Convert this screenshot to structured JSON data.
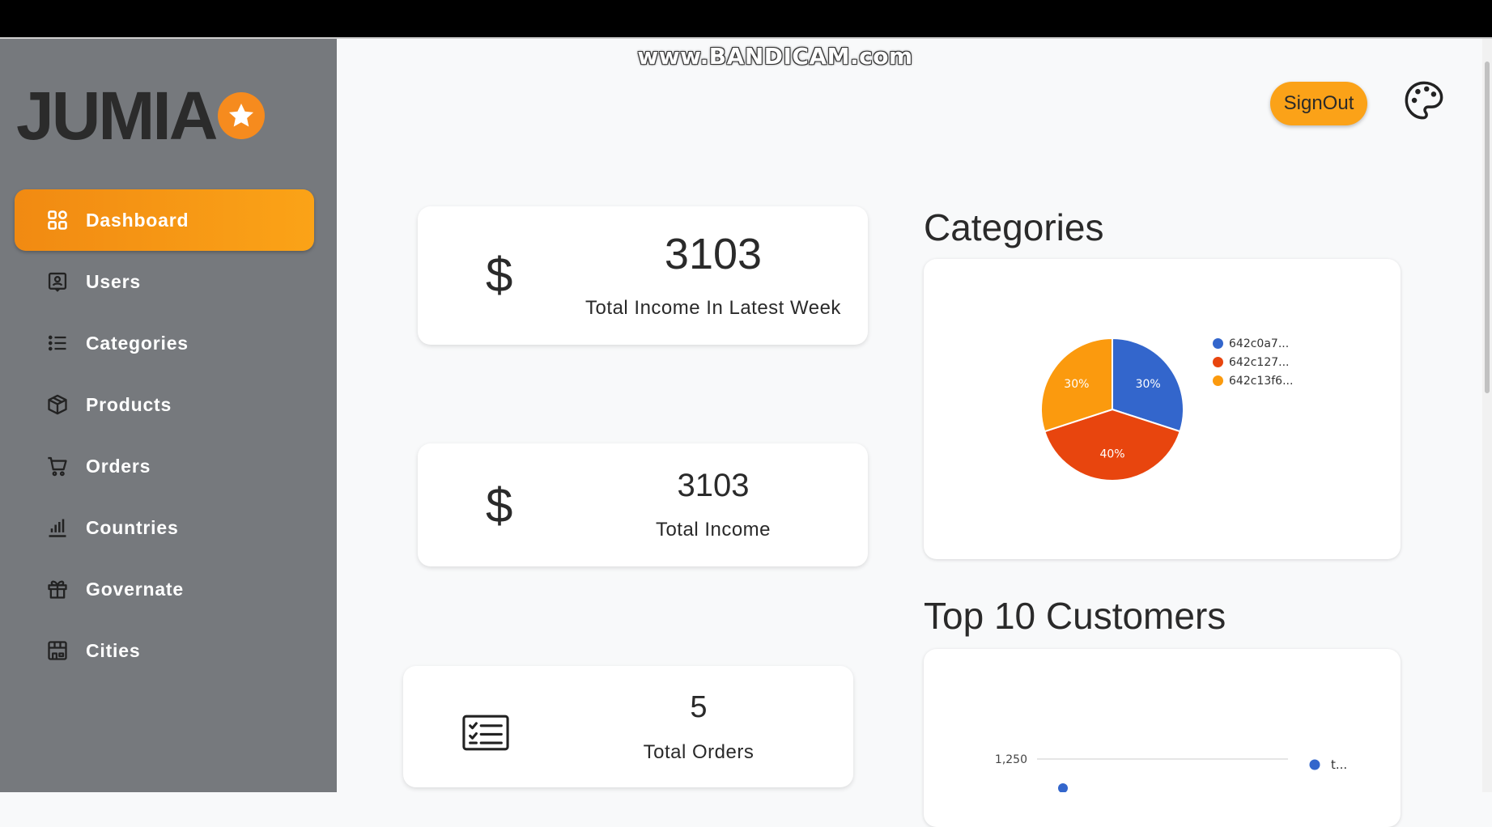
{
  "watermark": "www.BANDICAM.com",
  "brand": {
    "logo_text": "JUMIA",
    "logo_icon": "star-icon",
    "accent": "#f68b1e"
  },
  "sidebar": {
    "items": [
      {
        "label": "Dashboard",
        "icon": "dashboard-grid-icon",
        "active": true
      },
      {
        "label": "Users",
        "icon": "user-badge-icon",
        "active": false
      },
      {
        "label": "Categories",
        "icon": "list-icon",
        "active": false
      },
      {
        "label": "Products",
        "icon": "box-icon",
        "active": false
      },
      {
        "label": "Orders",
        "icon": "cart-icon",
        "active": false
      },
      {
        "label": "Countries",
        "icon": "bar-chart-icon",
        "active": false
      },
      {
        "label": "Governate",
        "icon": "gift-icon",
        "active": false
      },
      {
        "label": "Cities",
        "icon": "store-icon",
        "active": false
      }
    ]
  },
  "header": {
    "signout_label": "SignOut",
    "theme_icon": "palette-icon"
  },
  "stats": [
    {
      "icon": "$",
      "value": "3103",
      "label": "Total Income In Latest Week"
    },
    {
      "icon": "$",
      "value": "3103",
      "label": "Total Income"
    },
    {
      "icon": "checklist-icon",
      "value": "5",
      "label": "Total Orders"
    }
  ],
  "categories_section": {
    "title": "Categories"
  },
  "customers_section": {
    "title": "Top 10 Customers"
  },
  "chart_data": [
    {
      "type": "pie",
      "title": "Categories",
      "labels": [
        "642c0a7...",
        "642c127...",
        "642c13f6..."
      ],
      "values": [
        30,
        40,
        30
      ],
      "value_labels": [
        "30%",
        "40%",
        "30%"
      ],
      "colors": [
        "#3366cc",
        "#e8450e",
        "#fb9a0e"
      ],
      "legend": "right"
    },
    {
      "type": "scatter",
      "title": "Top 10 Customers",
      "y_tick_labels": [
        "1,250"
      ],
      "series": [
        {
          "name": "t...",
          "color": "#3366cc"
        }
      ],
      "legend": "right"
    }
  ]
}
